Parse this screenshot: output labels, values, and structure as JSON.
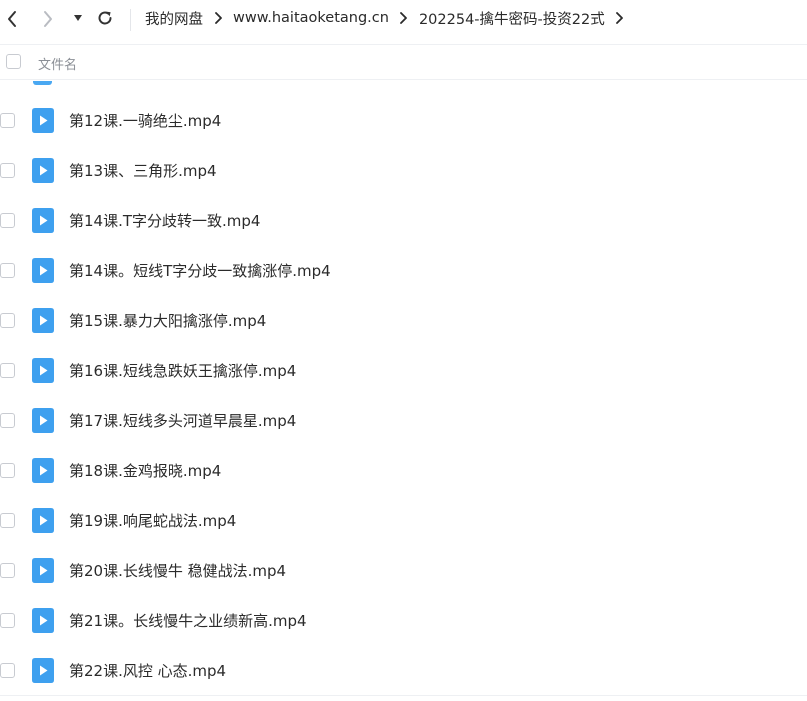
{
  "toolbar": {
    "back_icon": "chevron-left-icon",
    "forward_icon": "chevron-right-icon",
    "history_icon": "caret-down-icon",
    "refresh_icon": "refresh-icon"
  },
  "breadcrumb": {
    "items": [
      "我的网盘",
      "www.haitaoketang.cn",
      "202254-擒牛密码-投资22式"
    ]
  },
  "list_header": {
    "name_label": "文件名"
  },
  "colors": {
    "video_icon": "#3ea0ef",
    "text": "#2b2b2b",
    "header_text": "#8b8f96"
  },
  "files": [
    {
      "name": "第12课.一骑绝尘.mp4",
      "icon": "video-file-icon"
    },
    {
      "name": "第13课、三角形.mp4",
      "icon": "video-file-icon"
    },
    {
      "name": "第14课.T字分歧转一致.mp4",
      "icon": "video-file-icon"
    },
    {
      "name": "第14课。短线T字分歧一致擒涨停.mp4",
      "icon": "video-file-icon"
    },
    {
      "name": "第15课.暴力大阳擒涨停.mp4",
      "icon": "video-file-icon"
    },
    {
      "name": "第16课.短线急跌妖王擒涨停.mp4",
      "icon": "video-file-icon"
    },
    {
      "name": "第17课.短线多头河道早晨星.mp4",
      "icon": "video-file-icon"
    },
    {
      "name": "第18课.金鸡报晓.mp4",
      "icon": "video-file-icon"
    },
    {
      "name": "第19课.响尾蛇战法.mp4",
      "icon": "video-file-icon"
    },
    {
      "name": "第20课.长线慢牛 稳健战法.mp4",
      "icon": "video-file-icon"
    },
    {
      "name": "第21课。长线慢牛之业绩新高.mp4",
      "icon": "video-file-icon"
    },
    {
      "name": "第22课.风控  心态.mp4",
      "icon": "video-file-icon"
    }
  ]
}
